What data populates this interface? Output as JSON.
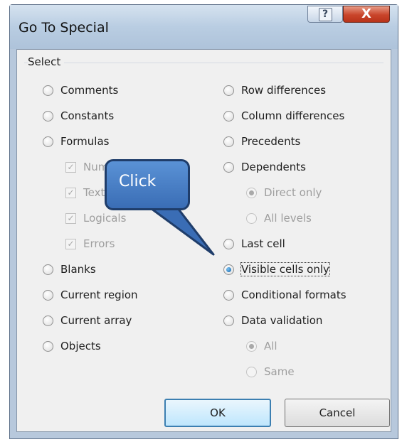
{
  "dialog": {
    "title": "Go To Special",
    "help_icon": "question-mark-icon",
    "help_glyph": "?",
    "close_icon": "close-x-icon",
    "close_glyph": "X"
  },
  "group": {
    "label": "Select"
  },
  "left_options": [
    {
      "label": "Comments",
      "state": "unchecked"
    },
    {
      "label": "Constants",
      "state": "unchecked"
    },
    {
      "label": "Formulas",
      "state": "unchecked"
    },
    {
      "label": "Numbers",
      "state": "checked-disabled"
    },
    {
      "label": "Text",
      "state": "checked-disabled"
    },
    {
      "label": "Logicals",
      "state": "checked-disabled"
    },
    {
      "label": "Errors",
      "state": "checked-disabled"
    },
    {
      "label": "Blanks",
      "state": "unchecked"
    },
    {
      "label": "Current region",
      "state": "unchecked"
    },
    {
      "label": "Current array",
      "state": "unchecked"
    },
    {
      "label": "Objects",
      "state": "unchecked"
    }
  ],
  "right_options": [
    {
      "label": "Row differences",
      "state": "unchecked"
    },
    {
      "label": "Column differences",
      "state": "unchecked"
    },
    {
      "label": "Precedents",
      "state": "unchecked"
    },
    {
      "label": "Dependents",
      "state": "unchecked"
    },
    {
      "label": "Direct only",
      "state": "checked-disabled"
    },
    {
      "label": "All levels",
      "state": "unchecked-disabled"
    },
    {
      "label": "Last cell",
      "state": "unchecked"
    },
    {
      "label": "Visible cells only",
      "state": "checked"
    },
    {
      "label": "Conditional formats",
      "state": "unchecked"
    },
    {
      "label": "Data validation",
      "state": "unchecked"
    },
    {
      "label": "All",
      "state": "checked-disabled"
    },
    {
      "label": "Same",
      "state": "unchecked-disabled"
    }
  ],
  "buttons": {
    "ok": "OK",
    "cancel": "Cancel"
  },
  "callout": {
    "text": "Click",
    "color": "#4a80c8"
  },
  "colors": {
    "accent": "#3c7fb1",
    "close": "#c9442a"
  }
}
